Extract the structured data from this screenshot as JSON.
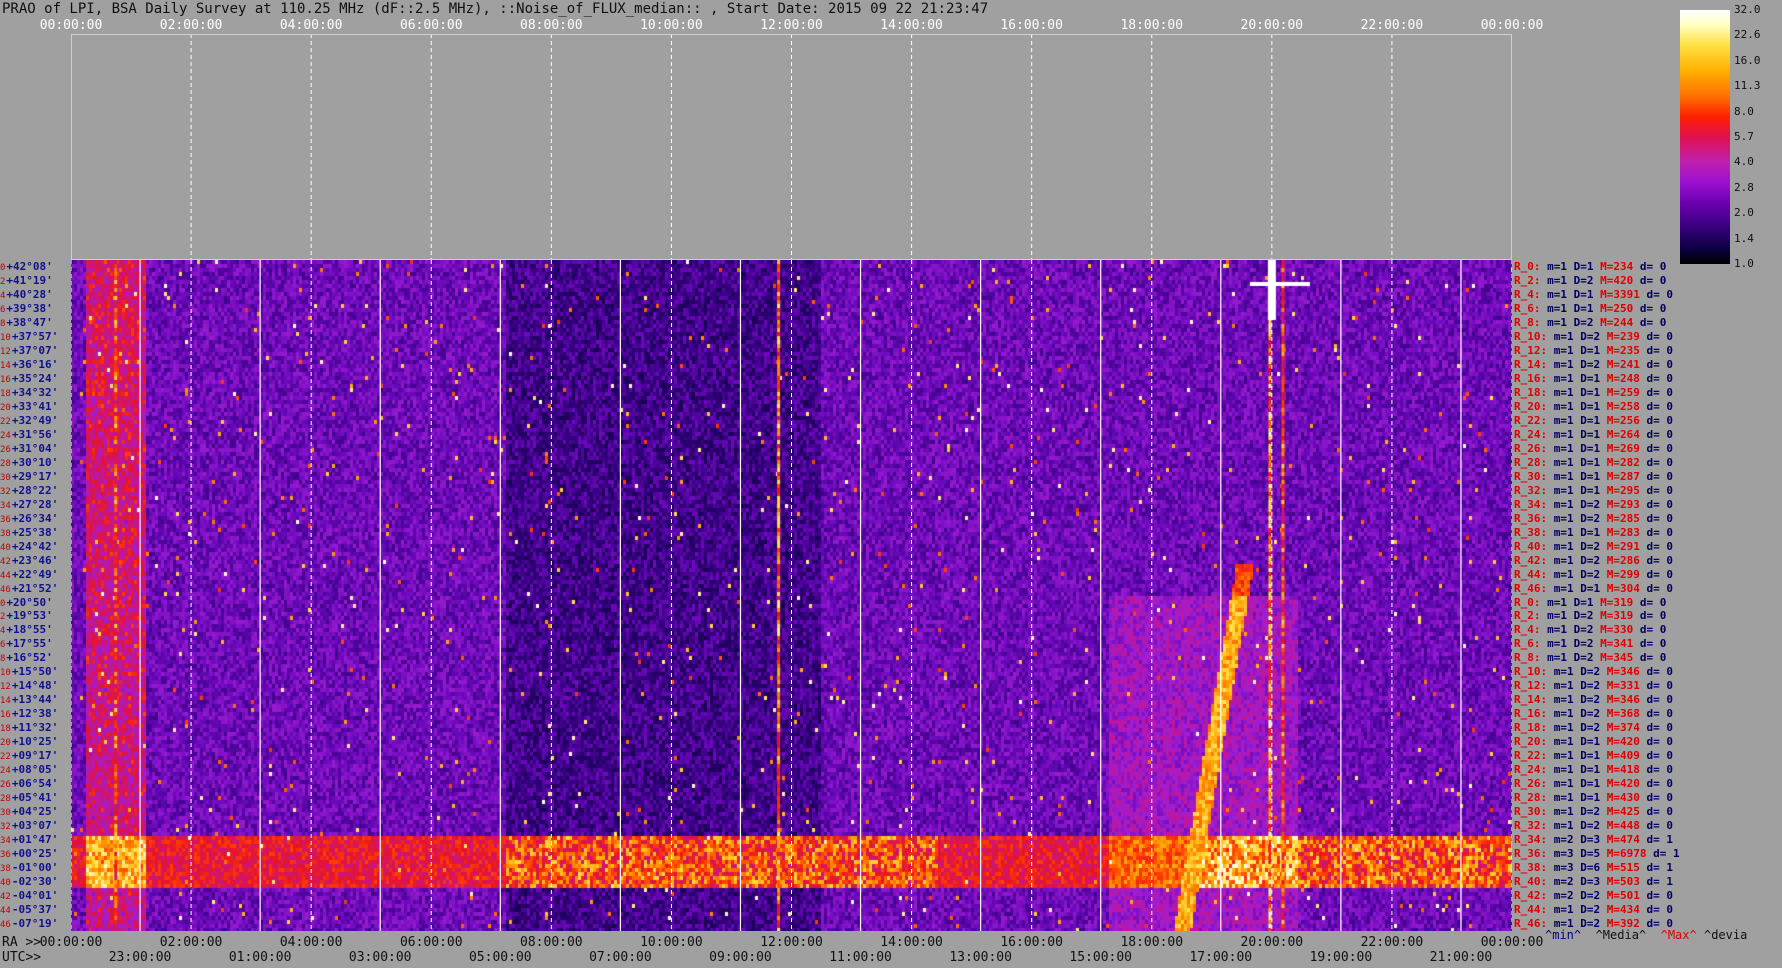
{
  "title": "PRAO of LPI, BSA Daily Survey at 110.25 MHz (dF::2.5 MHz), ::Noise_of_FLUX_median:: , Start Date: 2015 09 22 21:23:47",
  "colorbar": {
    "labels": [
      "32.0",
      "22.6",
      "16.0",
      "11.3",
      "8.0",
      "5.7",
      "4.0",
      "2.8",
      "2.0",
      "1.4",
      "1.0"
    ]
  },
  "axes": {
    "top_ticks": [
      "00:00:00",
      "02:00:00",
      "04:00:00",
      "06:00:00",
      "08:00:00",
      "10:00:00",
      "12:00:00",
      "14:00:00",
      "16:00:00",
      "18:00:00",
      "20:00:00",
      "22:00:00",
      "00:00:00"
    ],
    "ra_prefix": "RA >>",
    "ra_ticks": [
      "00:00:00",
      "02:00:00",
      "04:00:00",
      "06:00:00",
      "08:00:00",
      "10:00:00",
      "12:00:00",
      "14:00:00",
      "16:00:00",
      "18:00:00",
      "20:00:00",
      "22:00:00",
      "00:00:00"
    ],
    "utc_prefix": "UTC>>",
    "utc_ticks": [
      "23:00:00",
      "01:00:00",
      "03:00:00",
      "05:00:00",
      "07:00:00",
      "09:00:00",
      "11:00:00",
      "13:00:00",
      "15:00:00",
      "17:00:00",
      "19:00:00",
      "21:00:00"
    ]
  },
  "legend": {
    "min": "^min^",
    "median": "^Media^",
    "max": "^Max^",
    "devia": "^devia"
  },
  "chart_data": {
    "type": "heatmap",
    "title": "PRAO of LPI, BSA Daily Survey at 110.25 MHz (dF::2.5 MHz), ::Noise_of_FLUX_median:: , Start Date: 2015 09 22 21:23:47",
    "colorscale": {
      "min": 1.0,
      "max": 32.0,
      "scale": "log"
    },
    "declinations": [
      "+42°08'",
      "+41°19'",
      "+40°28'",
      "+39°38'",
      "+38°47'",
      "+37°57'",
      "+37°07'",
      "+36°16'",
      "+35°24'",
      "+34°32'",
      "+33°41'",
      "+32°49'",
      "+31°56'",
      "+31°04'",
      "+30°10'",
      "+29°17'",
      "+28°22'",
      "+27°28'",
      "+26°34'",
      "+25°38'",
      "+24°42'",
      "+23°46'",
      "+22°49'",
      "+21°52'",
      "+20°50'",
      "+19°53'",
      "+18°55'",
      "+17°55'",
      "+16°52'",
      "+15°50'",
      "+14°48'",
      "+13°44'",
      "+12°38'",
      "+11°32'",
      "+10°25'",
      "+09°17'",
      "+08°05'",
      "+06°54'",
      "+05°41'",
      "+04°25'",
      "+03°07'",
      "+01°47'",
      "+00°25'",
      "-01°00'",
      "-02°30'",
      "-04°01'",
      "-05°37'",
      "-07°19'"
    ],
    "row_index": [
      "0",
      "2",
      "4",
      "6",
      "8",
      "10",
      "12",
      "14",
      "16",
      "18",
      "20",
      "22",
      "24",
      "26",
      "28",
      "30",
      "32",
      "34",
      "36",
      "38",
      "40",
      "42",
      "44",
      "46",
      "0",
      "2",
      "4",
      "6",
      "8",
      "10",
      "12",
      "14",
      "16",
      "18",
      "20",
      "22",
      "24",
      "26",
      "28",
      "30",
      "32",
      "34",
      "36",
      "38",
      "40",
      "42",
      "44",
      "46"
    ],
    "row_stats": [
      {
        "r": "R_0:",
        "m": "m=1",
        "D": "D=1",
        "M": "M=234",
        "d": "d= 0"
      },
      {
        "r": "R_2:",
        "m": "m=1",
        "D": "D=2",
        "M": "M=420",
        "d": "d= 0"
      },
      {
        "r": "R_4:",
        "m": "m=1",
        "D": "D=1",
        "M": "M=3391",
        "d": "d= 0"
      },
      {
        "r": "R_6:",
        "m": "m=1",
        "D": "D=1",
        "M": "M=250",
        "d": "d= 0"
      },
      {
        "r": "R_8:",
        "m": "m=1",
        "D": "D=2",
        "M": "M=244",
        "d": "d= 0"
      },
      {
        "r": "R_10:",
        "m": "m=1",
        "D": "D=2",
        "M": "M=239",
        "d": "d= 0"
      },
      {
        "r": "R_12:",
        "m": "m=1",
        "D": "D=1",
        "M": "M=235",
        "d": "d= 0"
      },
      {
        "r": "R_14:",
        "m": "m=1",
        "D": "D=2",
        "M": "M=241",
        "d": "d= 0"
      },
      {
        "r": "R_16:",
        "m": "m=1",
        "D": "D=1",
        "M": "M=248",
        "d": "d= 0"
      },
      {
        "r": "R_18:",
        "m": "m=1",
        "D": "D=1",
        "M": "M=259",
        "d": "d= 0"
      },
      {
        "r": "R_20:",
        "m": "m=1",
        "D": "D=1",
        "M": "M=258",
        "d": "d= 0"
      },
      {
        "r": "R_22:",
        "m": "m=1",
        "D": "D=1",
        "M": "M=256",
        "d": "d= 0"
      },
      {
        "r": "R_24:",
        "m": "m=1",
        "D": "D=1",
        "M": "M=264",
        "d": "d= 0"
      },
      {
        "r": "R_26:",
        "m": "m=1",
        "D": "D=1",
        "M": "M=269",
        "d": "d= 0"
      },
      {
        "r": "R_28:",
        "m": "m=1",
        "D": "D=1",
        "M": "M=282",
        "d": "d= 0"
      },
      {
        "r": "R_30:",
        "m": "m=1",
        "D": "D=1",
        "M": "M=287",
        "d": "d= 0"
      },
      {
        "r": "R_32:",
        "m": "m=1",
        "D": "D=1",
        "M": "M=295",
        "d": "d= 0"
      },
      {
        "r": "R_34:",
        "m": "m=1",
        "D": "D=2",
        "M": "M=293",
        "d": "d= 0"
      },
      {
        "r": "R_36:",
        "m": "m=1",
        "D": "D=2",
        "M": "M=285",
        "d": "d= 0"
      },
      {
        "r": "R_38:",
        "m": "m=1",
        "D": "D=1",
        "M": "M=283",
        "d": "d= 0"
      },
      {
        "r": "R_40:",
        "m": "m=1",
        "D": "D=2",
        "M": "M=291",
        "d": "d= 0"
      },
      {
        "r": "R_42:",
        "m": "m=1",
        "D": "D=2",
        "M": "M=286",
        "d": "d= 0"
      },
      {
        "r": "R_44:",
        "m": "m=1",
        "D": "D=2",
        "M": "M=299",
        "d": "d= 0"
      },
      {
        "r": "R_46:",
        "m": "m=1",
        "D": "D=1",
        "M": "M=304",
        "d": "d= 0"
      },
      {
        "r": "R_0:",
        "m": "m=1",
        "D": "D=1",
        "M": "M=319",
        "d": "d= 0"
      },
      {
        "r": "R_2:",
        "m": "m=1",
        "D": "D=2",
        "M": "M=319",
        "d": "d= 0"
      },
      {
        "r": "R_4:",
        "m": "m=1",
        "D": "D=2",
        "M": "M=330",
        "d": "d= 0"
      },
      {
        "r": "R_6:",
        "m": "m=1",
        "D": "D=2",
        "M": "M=341",
        "d": "d= 0"
      },
      {
        "r": "R_8:",
        "m": "m=1",
        "D": "D=2",
        "M": "M=345",
        "d": "d= 0"
      },
      {
        "r": "R_10:",
        "m": "m=1",
        "D": "D=2",
        "M": "M=346",
        "d": "d= 0"
      },
      {
        "r": "R_12:",
        "m": "m=1",
        "D": "D=2",
        "M": "M=331",
        "d": "d= 0"
      },
      {
        "r": "R_14:",
        "m": "m=1",
        "D": "D=2",
        "M": "M=346",
        "d": "d= 0"
      },
      {
        "r": "R_16:",
        "m": "m=1",
        "D": "D=2",
        "M": "M=368",
        "d": "d= 0"
      },
      {
        "r": "R_18:",
        "m": "m=1",
        "D": "D=2",
        "M": "M=374",
        "d": "d= 0"
      },
      {
        "r": "R_20:",
        "m": "m=1",
        "D": "D=1",
        "M": "M=420",
        "d": "d= 0"
      },
      {
        "r": "R_22:",
        "m": "m=1",
        "D": "D=1",
        "M": "M=409",
        "d": "d= 0"
      },
      {
        "r": "R_24:",
        "m": "m=1",
        "D": "D=1",
        "M": "M=418",
        "d": "d= 0"
      },
      {
        "r": "R_26:",
        "m": "m=1",
        "D": "D=1",
        "M": "M=420",
        "d": "d= 0"
      },
      {
        "r": "R_28:",
        "m": "m=1",
        "D": "D=1",
        "M": "M=430",
        "d": "d= 0"
      },
      {
        "r": "R_30:",
        "m": "m=1",
        "D": "D=2",
        "M": "M=425",
        "d": "d= 0"
      },
      {
        "r": "R_32:",
        "m": "m=1",
        "D": "D=2",
        "M": "M=448",
        "d": "d= 0"
      },
      {
        "r": "R_34:",
        "m": "m=2",
        "D": "D=3",
        "M": "M=474",
        "d": "d= 1"
      },
      {
        "r": "R_36:",
        "m": "m=3",
        "D": "D=5",
        "M": "M=6978",
        "d": "d= 1"
      },
      {
        "r": "R_38:",
        "m": "m=3",
        "D": "D=6",
        "M": "M=515",
        "d": "d= 1"
      },
      {
        "r": "R_40:",
        "m": "m=2",
        "D": "D=3",
        "M": "M=503",
        "d": "d= 1"
      },
      {
        "r": "R_42:",
        "m": "m=2",
        "D": "D=2",
        "M": "M=501",
        "d": "d= 0"
      },
      {
        "r": "R_44:",
        "m": "m=1",
        "D": "D=2",
        "M": "M=434",
        "d": "d= 0"
      },
      {
        "r": "R_46:",
        "m": "m=1",
        "D": "D=2",
        "M": "M=392",
        "d": "d= 0"
      }
    ]
  }
}
